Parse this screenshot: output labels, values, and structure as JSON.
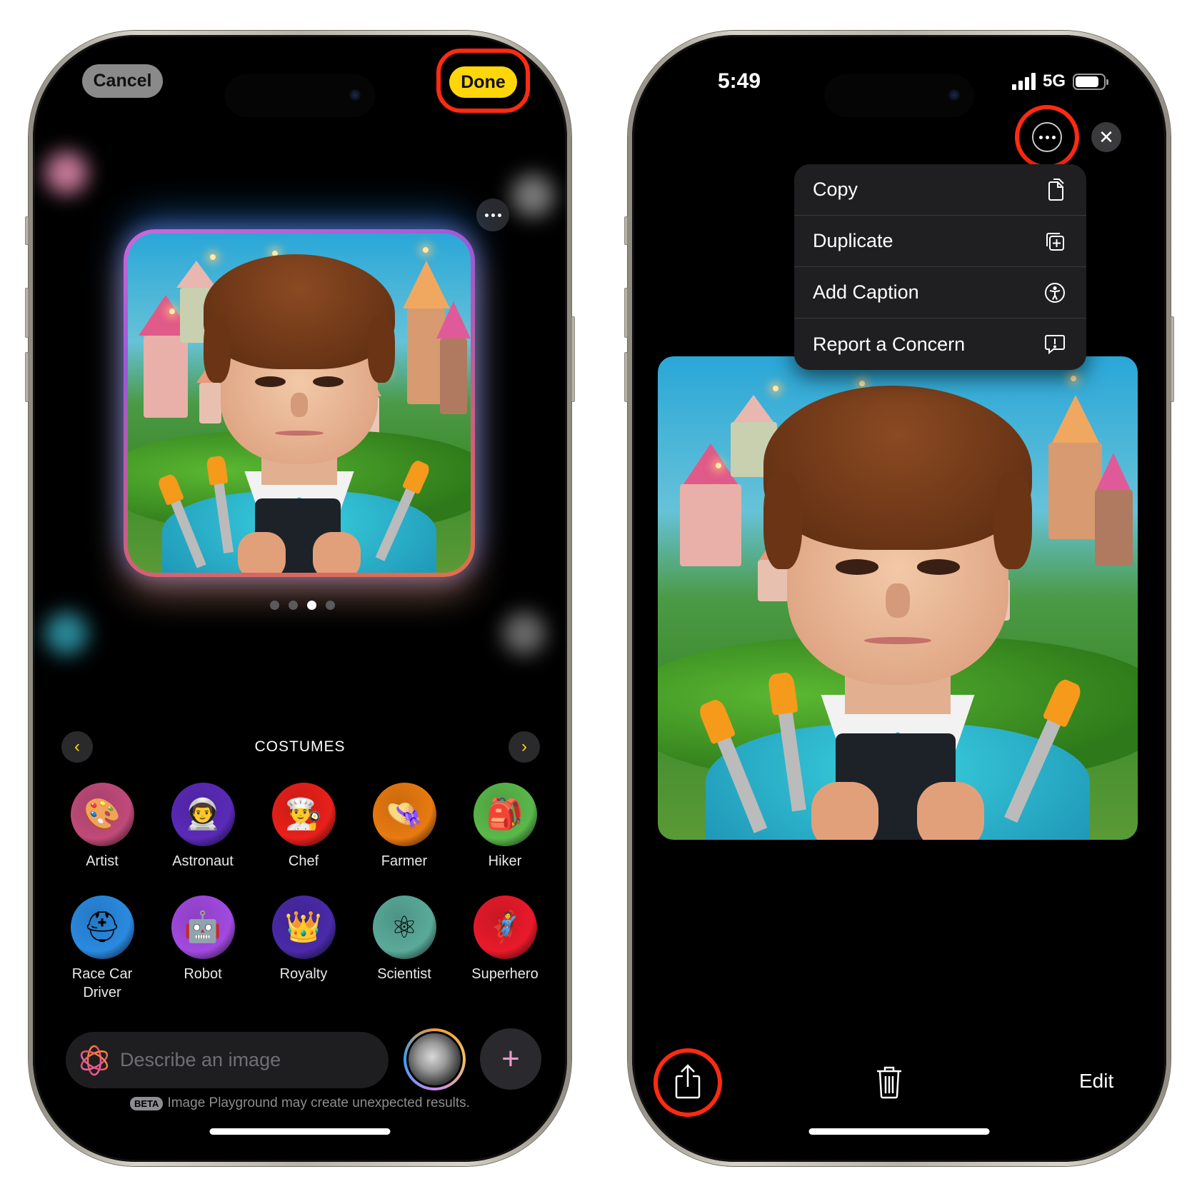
{
  "left_phone": {
    "header": {
      "cancel_label": "Cancel",
      "done_label": "Done",
      "more_icon": "ellipsis-icon"
    },
    "preview": {
      "page_count": 4,
      "active_page": 3
    },
    "section": {
      "title": "COSTUMES",
      "prev_icon": "chevron-left-icon",
      "next_icon": "chevron-right-icon",
      "accent_color": "#ffd60a"
    },
    "costumes": [
      {
        "label": "Artist",
        "icon": "palette-icon",
        "color": "#c04a7a"
      },
      {
        "label": "Astronaut",
        "icon": "astronaut-helmet-icon",
        "color": "#5a2ab8"
      },
      {
        "label": "Chef",
        "icon": "chef-hat-icon",
        "color": "#e8201a"
      },
      {
        "label": "Farmer",
        "icon": "straw-hat-icon",
        "color": "#e87a10"
      },
      {
        "label": "Hiker",
        "icon": "backpack-icon",
        "color": "#5ab84a"
      },
      {
        "label": "Race Car Driver",
        "icon": "racing-helmet-icon",
        "color": "#2a8ae0"
      },
      {
        "label": "Robot",
        "icon": "robot-icon",
        "color": "#a24ae0"
      },
      {
        "label": "Royalty",
        "icon": "scepter-icon",
        "color": "#4a2aa8"
      },
      {
        "label": "Scientist",
        "icon": "atom-icon",
        "color": "#5aaa9a"
      },
      {
        "label": "Superhero",
        "icon": "superhero-mask-icon",
        "color": "#e81a2a"
      }
    ],
    "prompt": {
      "placeholder": "Describe an image",
      "value": "",
      "plus_label": "+"
    },
    "disclaimer": {
      "badge": "BETA",
      "text": "Image Playground may create unexpected results."
    }
  },
  "right_phone": {
    "status_bar": {
      "time": "5:49",
      "network": "5G",
      "battery_level": 0.85
    },
    "context_menu": {
      "items": [
        {
          "label": "Copy",
          "icon": "copy-icon"
        },
        {
          "label": "Duplicate",
          "icon": "duplicate-icon"
        },
        {
          "label": "Add Caption",
          "icon": "accessibility-icon"
        },
        {
          "label": "Report a Concern",
          "icon": "report-bubble-icon"
        }
      ]
    },
    "toolbar": {
      "share_icon": "share-icon",
      "trash_icon": "trash-icon",
      "edit_label": "Edit"
    }
  },
  "annotation_color": "#ff2a12"
}
